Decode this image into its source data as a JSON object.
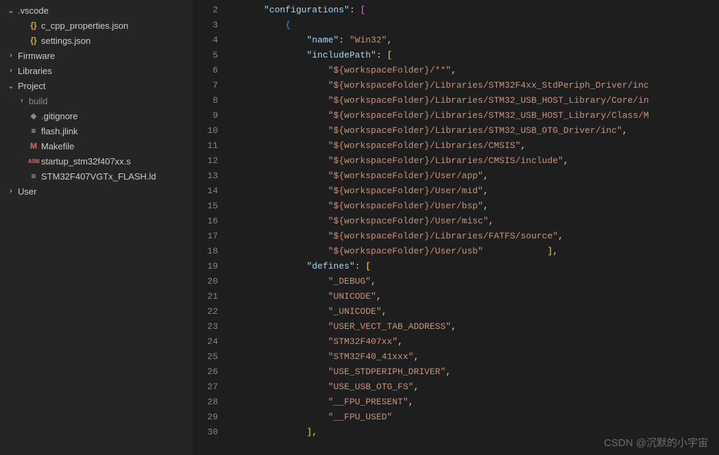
{
  "sidebar": {
    "items": [
      {
        "type": "folder",
        "expanded": true,
        "indent": 0,
        "label": ".vscode",
        "icon": ""
      },
      {
        "type": "file",
        "indent": 1,
        "label": "c_cpp_properties.json",
        "icon": "{}",
        "iconClass": "icon-json"
      },
      {
        "type": "file",
        "indent": 1,
        "label": "settings.json",
        "icon": "{}",
        "iconClass": "icon-json"
      },
      {
        "type": "folder",
        "expanded": false,
        "indent": 0,
        "label": "Firmware",
        "icon": ""
      },
      {
        "type": "folder",
        "expanded": false,
        "indent": 0,
        "label": "Libraries",
        "icon": ""
      },
      {
        "type": "folder",
        "expanded": true,
        "indent": 0,
        "label": "Project",
        "icon": ""
      },
      {
        "type": "folder",
        "expanded": false,
        "indent": 1,
        "label": "build",
        "icon": "",
        "dim": true
      },
      {
        "type": "file",
        "indent": 1,
        "label": ".gitignore",
        "icon": "◆",
        "iconClass": "icon-git"
      },
      {
        "type": "file",
        "indent": 1,
        "label": "flash.jlink",
        "icon": "≡",
        "iconClass": "icon-file"
      },
      {
        "type": "file",
        "indent": 1,
        "label": "Makefile",
        "icon": "M",
        "iconClass": "icon-makefile"
      },
      {
        "type": "file",
        "indent": 1,
        "label": "startup_stm32f407xx.s",
        "icon": "ASM",
        "iconClass": "icon-asm"
      },
      {
        "type": "file",
        "indent": 1,
        "label": "STM32F407VGTx_FLASH.ld",
        "icon": "≡",
        "iconClass": "icon-file"
      },
      {
        "type": "folder",
        "expanded": false,
        "indent": 0,
        "label": "User",
        "icon": ""
      }
    ]
  },
  "editor": {
    "startLine": 2,
    "endLine": 30,
    "lines": [
      {
        "parts": [
          {
            "t": "     ",
            "c": ""
          },
          {
            "t": "\"configurations\"",
            "c": "k"
          },
          {
            "t": ": ",
            "c": "p"
          },
          {
            "t": "[",
            "c": "b2"
          }
        ]
      },
      {
        "parts": [
          {
            "t": "         ",
            "c": ""
          },
          {
            "t": "{",
            "c": "b3"
          }
        ]
      },
      {
        "parts": [
          {
            "t": "             ",
            "c": ""
          },
          {
            "t": "\"name\"",
            "c": "k"
          },
          {
            "t": ": ",
            "c": "p"
          },
          {
            "t": "\"Win32\"",
            "c": "s"
          },
          {
            "t": ",",
            "c": "p"
          }
        ]
      },
      {
        "parts": [
          {
            "t": "             ",
            "c": ""
          },
          {
            "t": "\"includePath\"",
            "c": "k"
          },
          {
            "t": ": ",
            "c": "p"
          },
          {
            "t": "[",
            "c": "b1"
          }
        ]
      },
      {
        "parts": [
          {
            "t": "                 ",
            "c": ""
          },
          {
            "t": "\"${workspaceFolder}/**\"",
            "c": "s"
          },
          {
            "t": ",",
            "c": "p"
          }
        ]
      },
      {
        "parts": [
          {
            "t": "                 ",
            "c": ""
          },
          {
            "t": "\"${workspaceFolder}/Libraries/STM32F4xx_StdPeriph_Driver/inc",
            "c": "s"
          }
        ]
      },
      {
        "parts": [
          {
            "t": "                 ",
            "c": ""
          },
          {
            "t": "\"${workspaceFolder}/Libraries/STM32_USB_HOST_Library/Core/in",
            "c": "s"
          }
        ]
      },
      {
        "parts": [
          {
            "t": "                 ",
            "c": ""
          },
          {
            "t": "\"${workspaceFolder}/Libraries/STM32_USB_HOST_Library/Class/M",
            "c": "s"
          }
        ]
      },
      {
        "parts": [
          {
            "t": "                 ",
            "c": ""
          },
          {
            "t": "\"${workspaceFolder}/Libraries/STM32_USB_OTG_Driver/inc\"",
            "c": "s"
          },
          {
            "t": ",",
            "c": "p"
          }
        ]
      },
      {
        "parts": [
          {
            "t": "                 ",
            "c": ""
          },
          {
            "t": "\"${workspaceFolder}/Libraries/CMSIS\"",
            "c": "s"
          },
          {
            "t": ",",
            "c": "p"
          }
        ]
      },
      {
        "parts": [
          {
            "t": "                 ",
            "c": ""
          },
          {
            "t": "\"${workspaceFolder}/Libraries/CMSIS/include\"",
            "c": "s"
          },
          {
            "t": ",",
            "c": "p"
          }
        ]
      },
      {
        "parts": [
          {
            "t": "                 ",
            "c": ""
          },
          {
            "t": "\"${workspaceFolder}/User/app\"",
            "c": "s"
          },
          {
            "t": ",",
            "c": "p"
          }
        ]
      },
      {
        "parts": [
          {
            "t": "                 ",
            "c": ""
          },
          {
            "t": "\"${workspaceFolder}/User/mid\"",
            "c": "s"
          },
          {
            "t": ",",
            "c": "p"
          }
        ]
      },
      {
        "parts": [
          {
            "t": "                 ",
            "c": ""
          },
          {
            "t": "\"${workspaceFolder}/User/bsp\"",
            "c": "s"
          },
          {
            "t": ",",
            "c": "p"
          }
        ]
      },
      {
        "parts": [
          {
            "t": "                 ",
            "c": ""
          },
          {
            "t": "\"${workspaceFolder}/User/misc\"",
            "c": "s"
          },
          {
            "t": ",",
            "c": "p"
          }
        ]
      },
      {
        "parts": [
          {
            "t": "                 ",
            "c": ""
          },
          {
            "t": "\"${workspaceFolder}/Libraries/FATFS/source\"",
            "c": "s"
          },
          {
            "t": ",",
            "c": "p"
          }
        ]
      },
      {
        "parts": [
          {
            "t": "                 ",
            "c": ""
          },
          {
            "t": "\"${workspaceFolder}/User/usb\"",
            "c": "s"
          },
          {
            "t": "            ",
            "c": ""
          },
          {
            "t": "]",
            "c": "b1"
          },
          {
            "t": ",",
            "c": "p"
          }
        ]
      },
      {
        "parts": [
          {
            "t": "             ",
            "c": ""
          },
          {
            "t": "\"defines\"",
            "c": "k"
          },
          {
            "t": ": ",
            "c": "p"
          },
          {
            "t": "[",
            "c": "b1"
          }
        ]
      },
      {
        "parts": [
          {
            "t": "                 ",
            "c": ""
          },
          {
            "t": "\"_DEBUG\"",
            "c": "s"
          },
          {
            "t": ",",
            "c": "p"
          }
        ]
      },
      {
        "parts": [
          {
            "t": "                 ",
            "c": ""
          },
          {
            "t": "\"UNICODE\"",
            "c": "s"
          },
          {
            "t": ",",
            "c": "p"
          }
        ]
      },
      {
        "parts": [
          {
            "t": "                 ",
            "c": ""
          },
          {
            "t": "\"_UNICODE\"",
            "c": "s"
          },
          {
            "t": ",",
            "c": "p"
          }
        ]
      },
      {
        "parts": [
          {
            "t": "                 ",
            "c": ""
          },
          {
            "t": "\"USER_VECT_TAB_ADDRESS\"",
            "c": "s"
          },
          {
            "t": ",",
            "c": "p"
          }
        ]
      },
      {
        "parts": [
          {
            "t": "                 ",
            "c": ""
          },
          {
            "t": "\"STM32F407xx\"",
            "c": "s"
          },
          {
            "t": ",",
            "c": "p"
          }
        ]
      },
      {
        "parts": [
          {
            "t": "                 ",
            "c": ""
          },
          {
            "t": "\"STM32F40_41xxx\"",
            "c": "s"
          },
          {
            "t": ",",
            "c": "p"
          }
        ]
      },
      {
        "parts": [
          {
            "t": "                 ",
            "c": ""
          },
          {
            "t": "\"USE_STDPERIPH_DRIVER\"",
            "c": "s"
          },
          {
            "t": ",",
            "c": "p"
          }
        ]
      },
      {
        "parts": [
          {
            "t": "                 ",
            "c": ""
          },
          {
            "t": "\"USE_USB_OTG_FS\"",
            "c": "s"
          },
          {
            "t": ",",
            "c": "p"
          }
        ]
      },
      {
        "parts": [
          {
            "t": "                 ",
            "c": ""
          },
          {
            "t": "\"__FPU_PRESENT\"",
            "c": "s"
          },
          {
            "t": ",",
            "c": "p"
          }
        ]
      },
      {
        "parts": [
          {
            "t": "                 ",
            "c": ""
          },
          {
            "t": "\"__FPU_USED\"",
            "c": "s"
          }
        ]
      },
      {
        "parts": [
          {
            "t": "             ",
            "c": ""
          },
          {
            "t": "]",
            "c": "b1"
          },
          {
            "t": ",",
            "c": "p"
          }
        ]
      }
    ]
  },
  "watermark": "CSDN @沉默的小宇宙"
}
